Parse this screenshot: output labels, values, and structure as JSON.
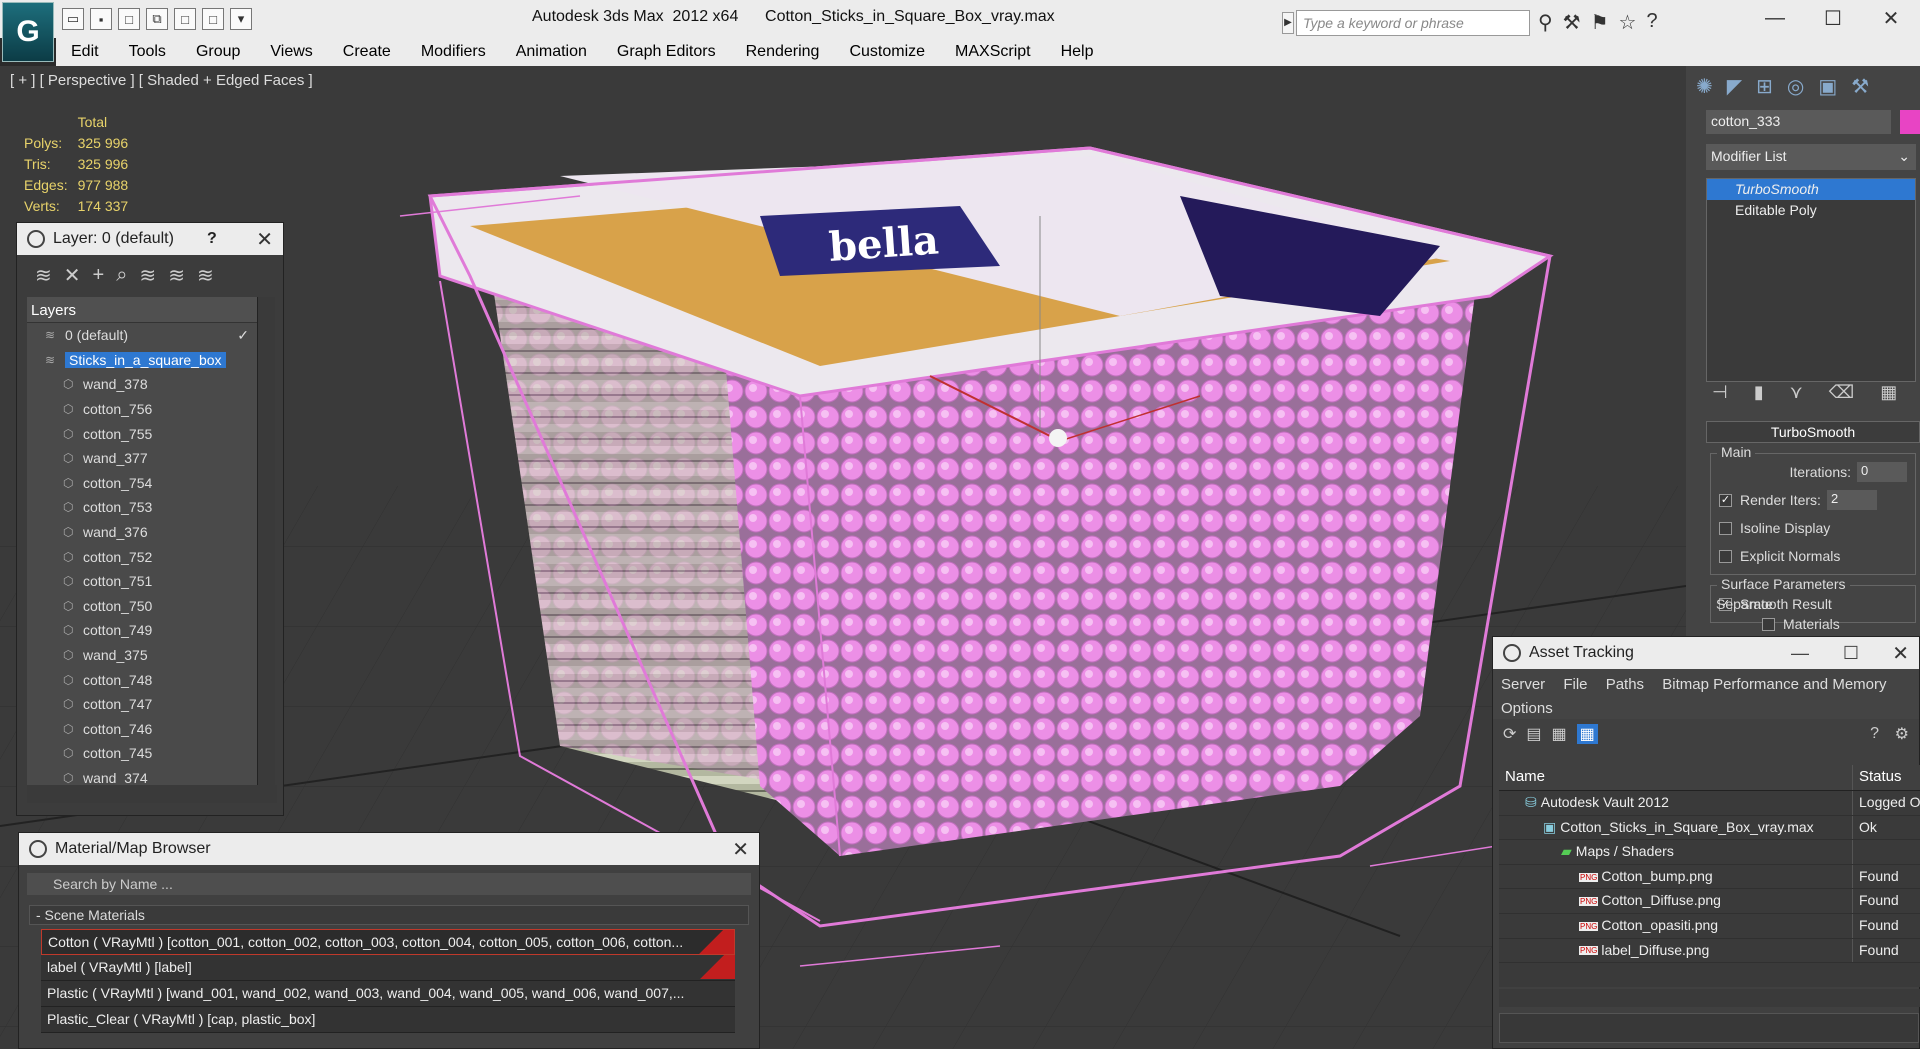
{
  "window": {
    "app_title": "Autodesk 3ds Max  2012 x64",
    "file_title": "Cotton_Sticks_in_Square_Box_vray.max",
    "search_placeholder": "Type a keyword or phrase"
  },
  "menu": [
    "Edit",
    "Tools",
    "Group",
    "Views",
    "Create",
    "Modifiers",
    "Animation",
    "Graph Editors",
    "Rendering",
    "Customize",
    "MAXScript",
    "Help"
  ],
  "viewport": {
    "label": "[ + ] [ Perspective ] [ Shaded + Edged Faces ]",
    "stats": {
      "header": "Total",
      "rows": [
        {
          "label": "Polys:",
          "value": "325 996"
        },
        {
          "label": "Tris:",
          "value": "325 996"
        },
        {
          "label": "Edges:",
          "value": "977 988"
        },
        {
          "label": "Verts:",
          "value": "174 337"
        }
      ]
    },
    "box_label_text": "bella"
  },
  "layer_panel": {
    "title": "Layer: 0 (default)",
    "help": "?",
    "header": "Layers",
    "rows": [
      {
        "name": "0 (default)",
        "indent": 1,
        "type": "layer"
      },
      {
        "name": "Sticks_in_a_square_box",
        "indent": 1,
        "type": "layer",
        "selected": true
      },
      {
        "name": "wand_378",
        "indent": 2,
        "type": "object"
      },
      {
        "name": "cotton_756",
        "indent": 2,
        "type": "object"
      },
      {
        "name": "cotton_755",
        "indent": 2,
        "type": "object"
      },
      {
        "name": "wand_377",
        "indent": 2,
        "type": "object"
      },
      {
        "name": "cotton_754",
        "indent": 2,
        "type": "object"
      },
      {
        "name": "cotton_753",
        "indent": 2,
        "type": "object"
      },
      {
        "name": "wand_376",
        "indent": 2,
        "type": "object"
      },
      {
        "name": "cotton_752",
        "indent": 2,
        "type": "object"
      },
      {
        "name": "cotton_751",
        "indent": 2,
        "type": "object"
      },
      {
        "name": "cotton_750",
        "indent": 2,
        "type": "object"
      },
      {
        "name": "cotton_749",
        "indent": 2,
        "type": "object"
      },
      {
        "name": "wand_375",
        "indent": 2,
        "type": "object"
      },
      {
        "name": "cotton_748",
        "indent": 2,
        "type": "object"
      },
      {
        "name": "cotton_747",
        "indent": 2,
        "type": "object"
      },
      {
        "name": "cotton_746",
        "indent": 2,
        "type": "object"
      },
      {
        "name": "cotton_745",
        "indent": 2,
        "type": "object"
      },
      {
        "name": "wand_374",
        "indent": 2,
        "type": "object"
      }
    ]
  },
  "material_browser": {
    "title": "Material/Map Browser",
    "search_placeholder": "Search by Name ...",
    "section": "- Scene Materials",
    "rows": [
      {
        "text": "Cotton  ( VRayMtl ) [cotton_001, cotton_002, cotton_003, cotton_004, cotton_005, cotton_006, cotton...",
        "selected": true
      },
      {
        "text": "label  ( VRayMtl ) [label]",
        "selected": false
      },
      {
        "text": "Plastic  ( VRayMtl )  [wand_001, wand_002, wand_003, wand_004, wand_005, wand_006, wand_007,...",
        "selected": false
      },
      {
        "text": "Plastic_Clear  ( VRayMtl ) [cap, plastic_box]",
        "selected": false
      }
    ]
  },
  "command_panel": {
    "object_name": "cotton_333",
    "object_color": "#e844c4",
    "modifier_list": "Modifier List",
    "stack": [
      {
        "name": "TurboSmooth",
        "selected": true
      },
      {
        "name": "Editable Poly",
        "selected": false
      }
    ],
    "turbosmooth": {
      "title": "TurboSmooth",
      "main_label": "Main",
      "iterations_label": "Iterations:",
      "iterations_value": "0",
      "render_iters_label": "Render Iters:",
      "render_iters_value": "2",
      "render_iters_checked": true,
      "isoline_label": "Isoline Display",
      "explicit_label": "Explicit Normals",
      "surface_label": "Surface Parameters",
      "smooth_result_label": "Smooth Result",
      "separate_label": "Separate",
      "materials_label": "Materials"
    }
  },
  "asset_tracking": {
    "title": "Asset Tracking",
    "menu": [
      "Server",
      "File",
      "Paths",
      "Bitmap Performance and Memory",
      "Options"
    ],
    "col_name": "Name",
    "col_status": "Status",
    "rows": [
      {
        "name": "Autodesk Vault 2012",
        "status": "Logged O",
        "indent": 1,
        "icon": "vault"
      },
      {
        "name": "Cotton_Sticks_in_Square_Box_vray.max",
        "status": "Ok",
        "indent": 2,
        "icon": "max"
      },
      {
        "name": "Maps / Shaders",
        "status": "",
        "indent": 3,
        "icon": "maps"
      },
      {
        "name": "Cotton_bump.png",
        "status": "Found",
        "indent": 4,
        "icon": "png"
      },
      {
        "name": "Cotton_Diffuse.png",
        "status": "Found",
        "indent": 4,
        "icon": "png"
      },
      {
        "name": "Cotton_opasiti.png",
        "status": "Found",
        "indent": 4,
        "icon": "png"
      },
      {
        "name": "label_Diffuse.png",
        "status": "Found",
        "indent": 4,
        "icon": "png"
      }
    ]
  }
}
